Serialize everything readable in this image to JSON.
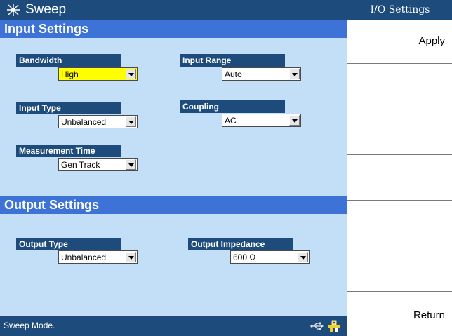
{
  "title": "Sweep",
  "sections": {
    "input": {
      "heading": "Input Settings",
      "fields": {
        "bandwidth": {
          "label": "Bandwidth",
          "value": "High"
        },
        "input_range": {
          "label": "Input Range",
          "value": "Auto"
        },
        "input_type": {
          "label": "Input Type",
          "value": "Unbalanced"
        },
        "coupling": {
          "label": "Coupling",
          "value": "AC"
        },
        "measurement_time": {
          "label": "Measurement Time",
          "value": "Gen Track"
        }
      }
    },
    "output": {
      "heading": "Output Settings",
      "fields": {
        "output_type": {
          "label": "Output Type",
          "value": "Unbalanced"
        },
        "output_impedance": {
          "label": "Output Impedance",
          "value": "600 Ω"
        }
      }
    }
  },
  "status": {
    "text": "Sweep Mode."
  },
  "softkeys": {
    "title": "I/O Settings",
    "apply": "Apply",
    "return": "Return"
  },
  "colors": {
    "bar_navy": "#1d4b7b",
    "section_blue": "#3d73d6",
    "panel_bg": "#c3dff7",
    "highlight": "#ffff00"
  },
  "icons": [
    "sweep-icon",
    "usb-icon",
    "system-icon",
    "dropdown-arrow-icon"
  ]
}
